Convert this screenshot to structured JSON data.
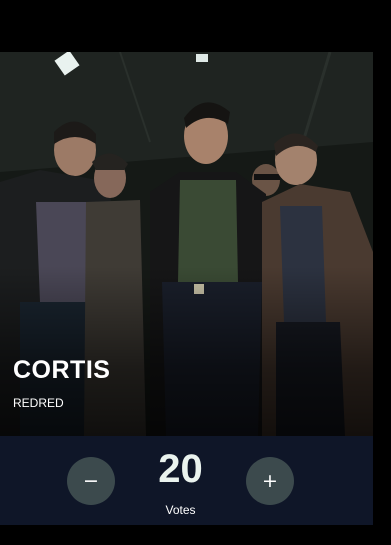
{
  "card": {
    "title": "CORTIS",
    "subtitle": "REDRED",
    "image_alt": "group-photo"
  },
  "vote": {
    "count": "20",
    "label": "Votes",
    "decrement_symbol": "−",
    "increment_symbol": "+"
  },
  "colors": {
    "page_background": "#000000",
    "vote_bar_background": "#0f1628",
    "vote_button_background": "#3c4a4d",
    "vote_count_color": "#eaf3ee",
    "text_color": "#ffffff"
  }
}
